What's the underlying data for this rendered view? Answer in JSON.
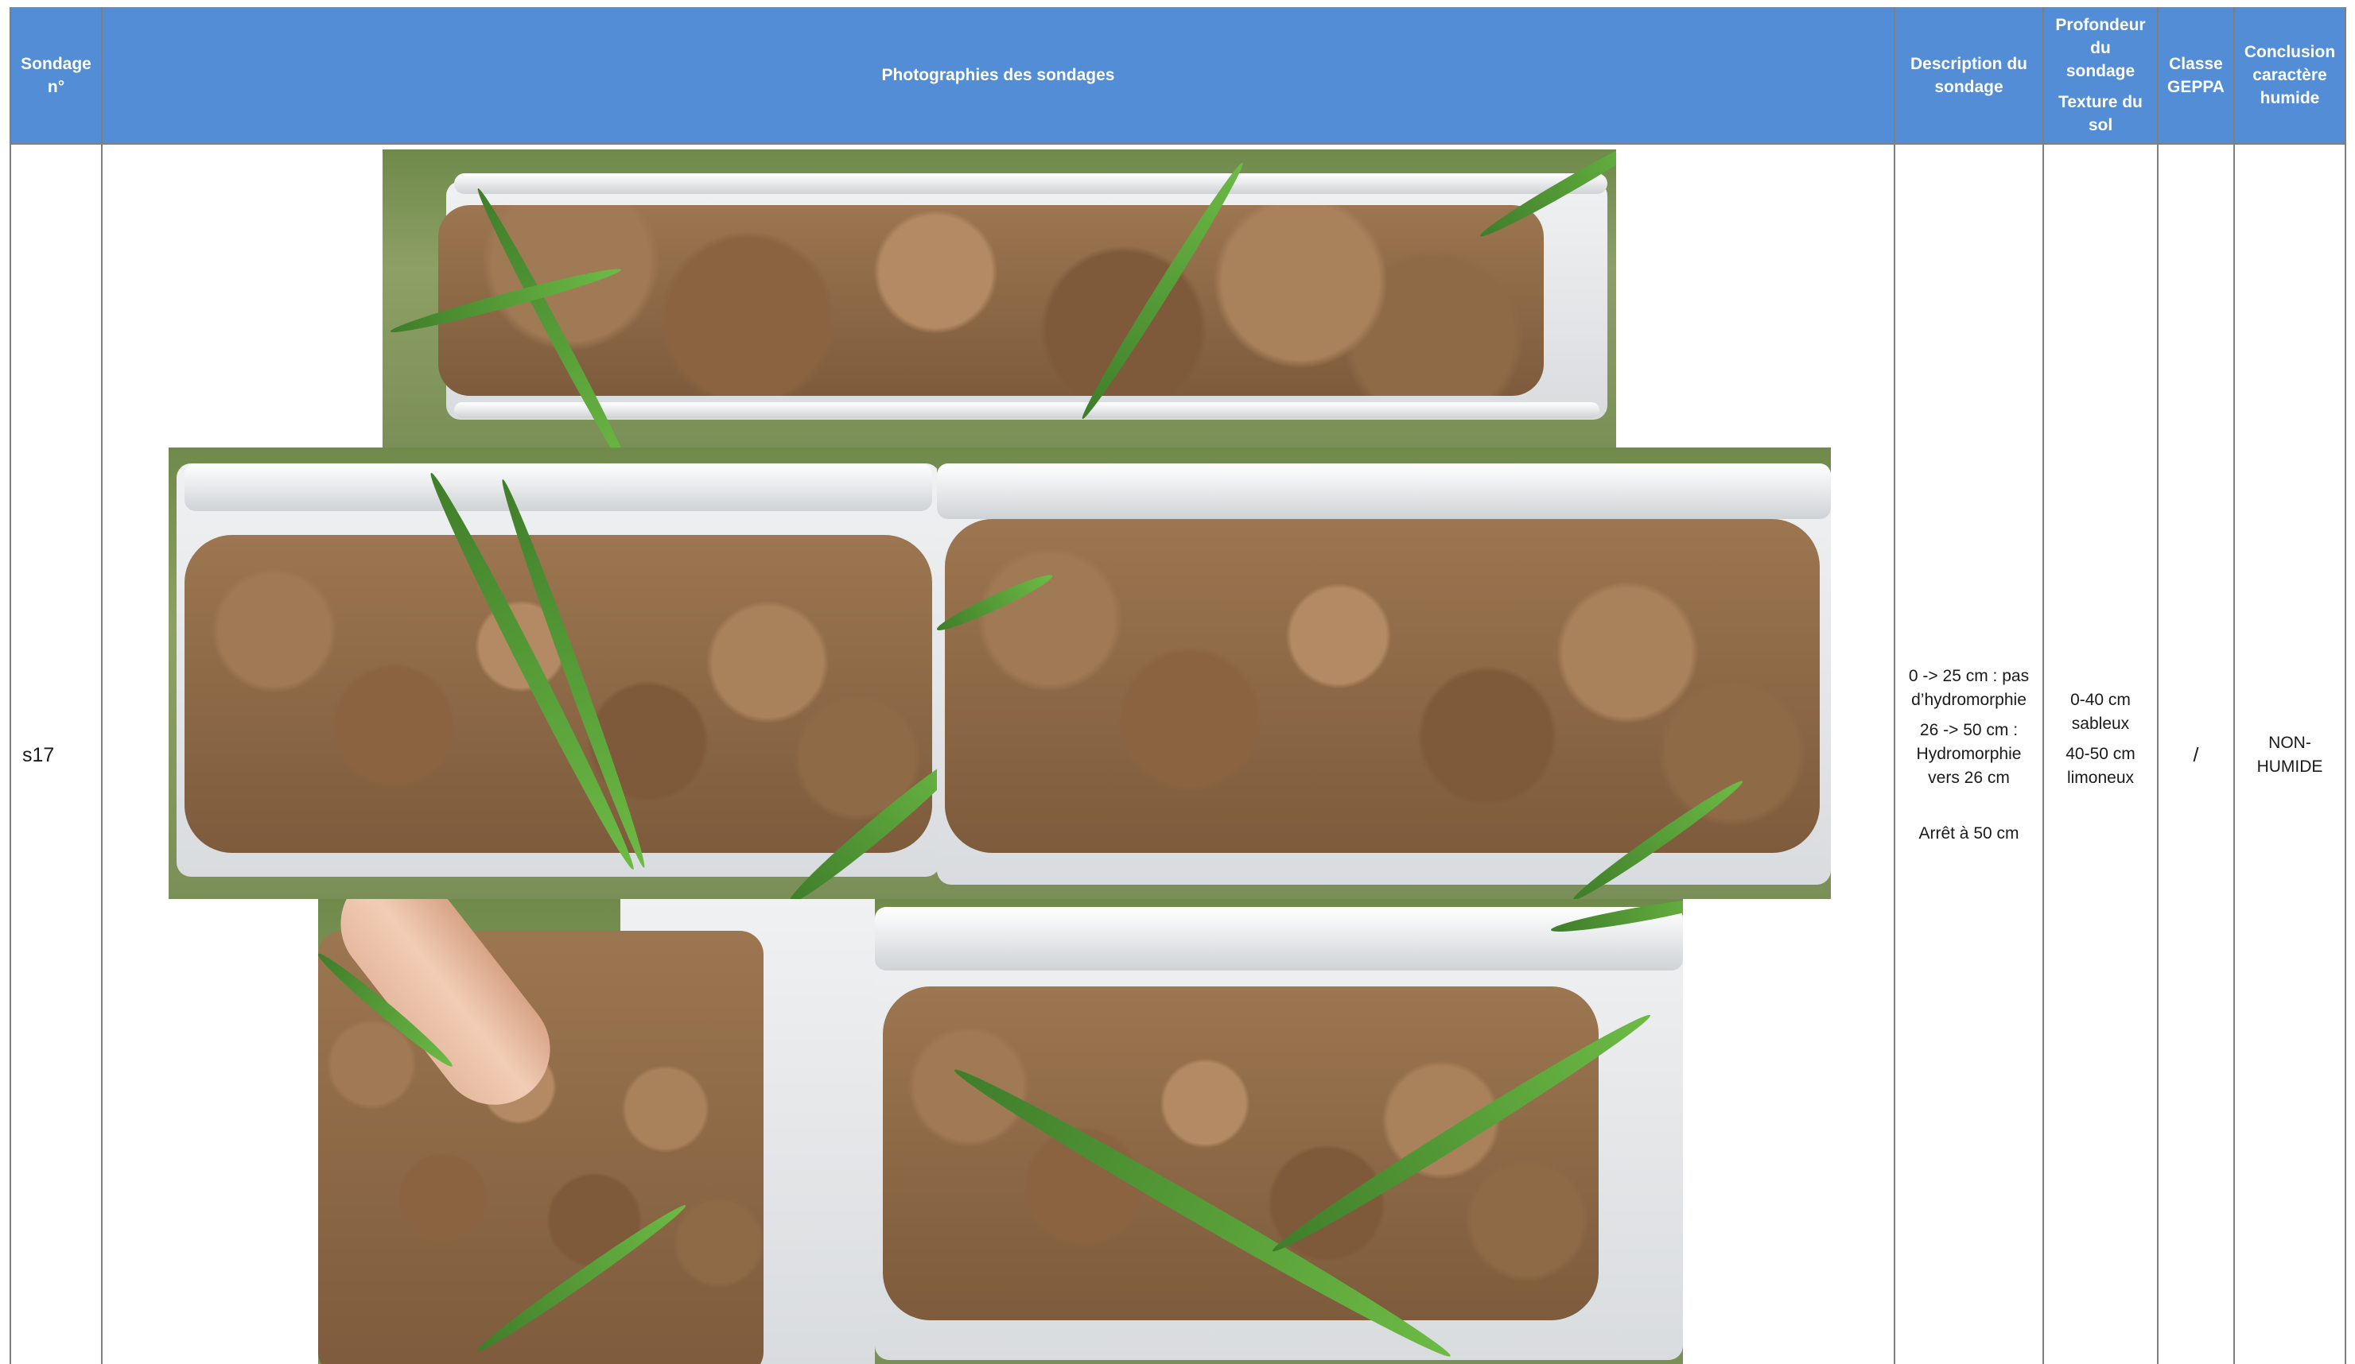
{
  "header": {
    "col_sondage": [
      "Sondage",
      "n°"
    ],
    "col_photos": "Photographies des sondages",
    "col_description": [
      "Description du",
      "sondage"
    ],
    "col_profondeur": [
      "Profondeur",
      "du",
      "sondage"
    ],
    "col_texture": [
      "Texture du",
      "sol"
    ],
    "col_classe": [
      "Classe",
      "GEPPA"
    ],
    "col_conclusion": [
      "Conclusion",
      "caractère",
      "humide"
    ]
  },
  "row": {
    "sondage_id": "s17",
    "description": {
      "line1": [
        "0 -> 25 cm :  pas",
        "d’hydromorphie"
      ],
      "line2": [
        "26 -> 50 cm :",
        "Hydromorphie",
        "vers 26 cm"
      ],
      "line3": "Arrêt à 50 cm"
    },
    "profondeur_texture": {
      "layer1": [
        "0-40 cm",
        "sableux"
      ],
      "layer2": [
        "40-50 cm",
        "limoneux"
      ]
    },
    "classe_geppa": "/",
    "conclusion": [
      "NON-",
      "HUMIDE"
    ]
  },
  "colors": {
    "header_bg": "#538dd5",
    "header_text": "#ffffff",
    "grid": "#7f7f7f"
  }
}
